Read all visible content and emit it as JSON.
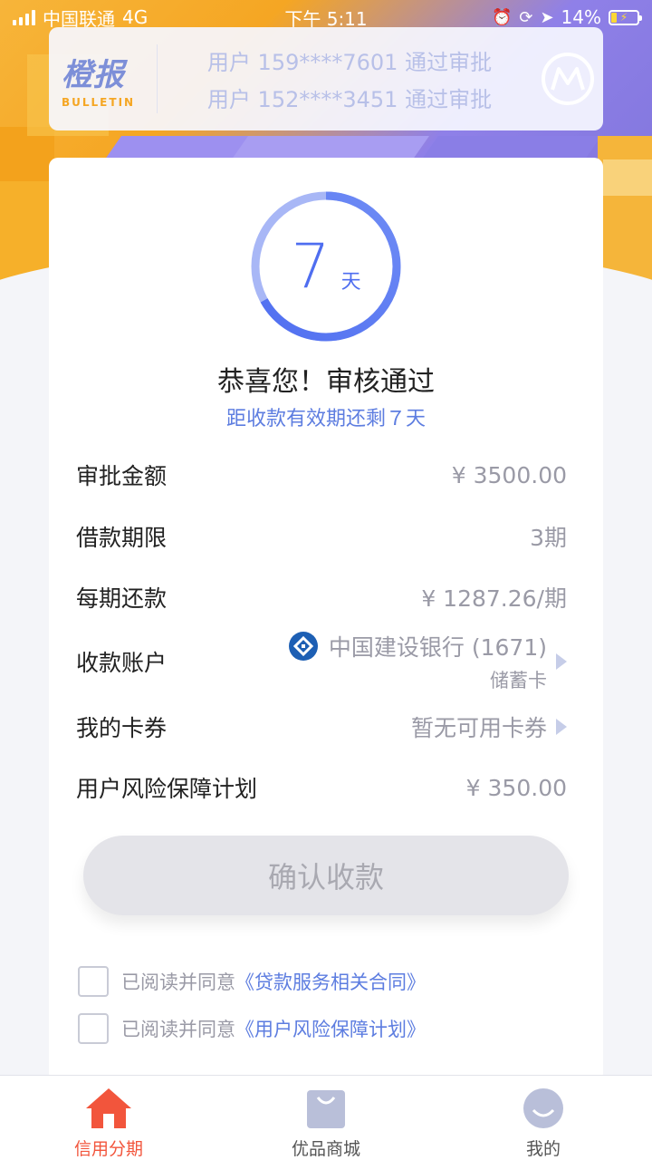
{
  "status_bar": {
    "carrier": "中国联通",
    "network": "4G",
    "time": "下午 5:11",
    "battery": "14%"
  },
  "bulletin": {
    "logo_cn": "橙报",
    "logo_en": "BULLETIN",
    "messages": [
      "用户 159****7601 通过审批",
      "用户 152****3451 通过审批"
    ]
  },
  "countdown": {
    "number": "7",
    "unit": "天",
    "fraction_remaining": 0.33
  },
  "result": {
    "title": "恭喜您！审核通过",
    "subtitle": "距收款有效期还剩７天"
  },
  "details": {
    "amount": {
      "label": "审批金额",
      "value": "¥ 3500.00"
    },
    "term": {
      "label": "借款期限",
      "value": "3期"
    },
    "installment": {
      "label": "每期还款",
      "value": "¥ 1287.26/期"
    },
    "account": {
      "label": "收款账户",
      "bank": "中国建设银行 (1671)",
      "card_type": "储蓄卡"
    },
    "coupons": {
      "label": "我的卡券",
      "value": "暂无可用卡券"
    },
    "insurance": {
      "label": "用户风险保障计划",
      "value": "¥ 350.00"
    }
  },
  "confirm_button": "确认收款",
  "agreements": [
    {
      "prefix": "已阅读并同意",
      "link": "《贷款服务相关合同》"
    },
    {
      "prefix": "已阅读并同意",
      "link": "《用户风险保障计划》"
    }
  ],
  "tabbar": [
    {
      "label": "信用分期",
      "icon": "home-icon",
      "active": true
    },
    {
      "label": "优品商城",
      "icon": "shopping-bag-icon",
      "active": false
    },
    {
      "label": "我的",
      "icon": "profile-icon",
      "active": false
    }
  ],
  "colors": {
    "accent": "#4f6ef0",
    "link": "#5d7de0",
    "active_tab": "#f2553c"
  }
}
